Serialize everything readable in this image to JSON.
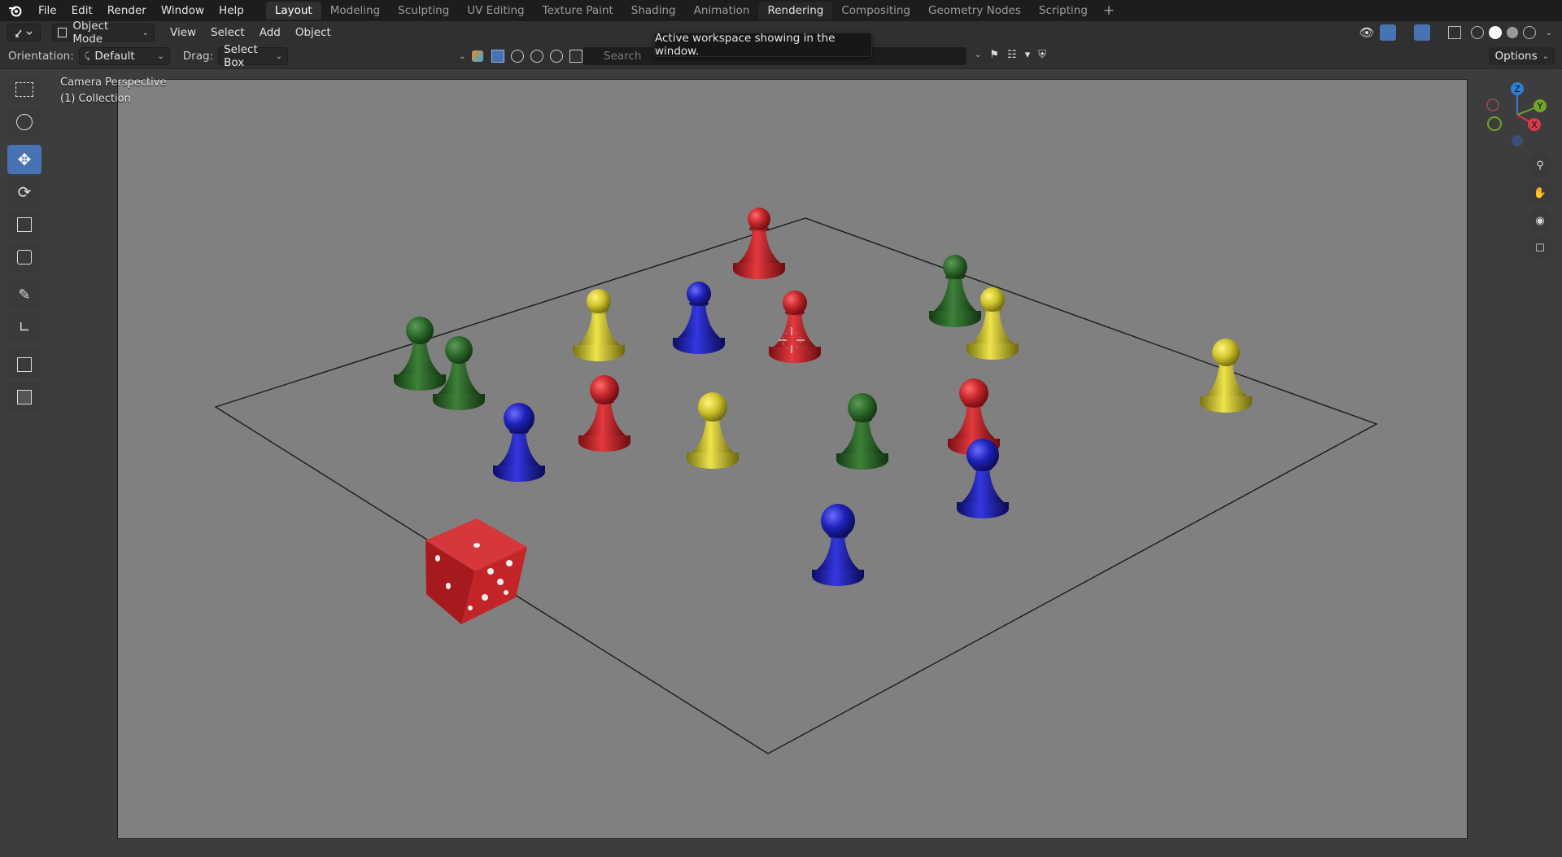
{
  "menu": {
    "file": "File",
    "edit": "Edit",
    "render": "Render",
    "window": "Window",
    "help": "Help"
  },
  "workspaces": [
    "Layout",
    "Modeling",
    "Sculpting",
    "UV Editing",
    "Texture Paint",
    "Shading",
    "Animation",
    "Rendering",
    "Compositing",
    "Geometry Nodes",
    "Scripting"
  ],
  "workspace_add": "+",
  "header": {
    "mode": "Object Mode",
    "view": "View",
    "select": "Select",
    "add": "Add",
    "object": "Object"
  },
  "toolbar_header": {
    "orientation_label": "Orientation:",
    "orientation_value": "Default",
    "drag_label": "Drag:",
    "drag_value": "Select Box",
    "options": "Options"
  },
  "tooltip": "Active workspace showing in the window.",
  "search": {
    "placeholder": "Search"
  },
  "viewport": {
    "perspective": "Camera Perspective",
    "collection": "(1) Collection"
  },
  "gizmo": {
    "x": "X",
    "y": "Y",
    "z": "Z"
  },
  "colors": {
    "accent": "#4772b3",
    "red": "#c4262b",
    "green": "#2e6b2c",
    "yellow": "#cfc52c",
    "blue": "#1f22b8"
  }
}
